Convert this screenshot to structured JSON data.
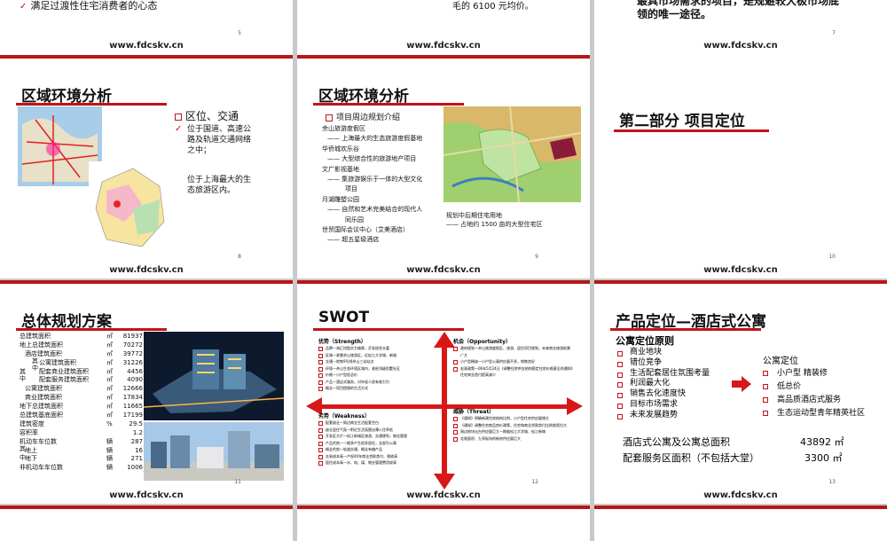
{
  "footer_url": "www.fdcskv.cn",
  "colors": {
    "accent": "#c0141b",
    "background": "#c9c9c9"
  },
  "slide5": {
    "bullet": "满足过渡性住宅消费者的心态",
    "num": "5"
  },
  "slide6": {
    "text": "毛的 6100 元均价。",
    "num": ""
  },
  "slide7": {
    "line1": "最具市场需求的项目，是规避较大极市场底",
    "line2": "领的唯一途径。",
    "num": "7"
  },
  "slide8": {
    "title": "区域环境分析",
    "heading": "区位、交通",
    "item1": [
      "位于国道、高速公",
      "路及轨道交通网络",
      "之中；"
    ],
    "item2": [
      "位于上海最大的生",
      "态旅游区内。"
    ],
    "num": "8"
  },
  "slide9": {
    "title": "区域环境分析",
    "heading": "项目周边规划介绍",
    "lines": [
      "佘山旅游度假区",
      "—— 上海最大的生态旅游度假基地",
      "华侨城欢乐谷",
      "—— 大型综合性的旅游地产项目",
      "文广影视基地",
      "—— 集旅游娱乐于一体的大型文化",
      "项目",
      "月湖雕塑公园",
      "—— 自然和艺术完美结合的现代人",
      "同乐园",
      "世贸国际会议中心（艾美酒店）",
      "—— 超五星级酒店"
    ],
    "note1": "规划中后期住宅用地",
    "note2": "—— 占地约 1500 亩的大型住宅区",
    "num": "9"
  },
  "slide10": {
    "title": "第二部分  项目定位",
    "num": "10"
  },
  "slide11": {
    "title": "总体规划方案",
    "rows": [
      {
        "label": "总建筑面积",
        "unit": "㎡",
        "value": "81937"
      },
      {
        "label": "地上总建筑面积",
        "unit": "㎡",
        "value": "70272"
      },
      {
        "label": "酒店建筑面积",
        "unit": "㎡",
        "value": "39772"
      },
      {
        "label": "公寓建筑面积",
        "unit": "㎡",
        "value": "31226"
      },
      {
        "label": "配套商业建筑面积",
        "unit": "㎡",
        "value": "4456"
      },
      {
        "label": "配套服务建筑面积",
        "unit": "㎡",
        "value": "4090"
      },
      {
        "label": "公寓建筑面积",
        "unit": "㎡",
        "value": "12666"
      },
      {
        "label": "商业建筑面积",
        "unit": "㎡",
        "value": "17834"
      },
      {
        "label": "地下总建筑面积",
        "unit": "㎡",
        "value": "11665"
      },
      {
        "label": "总建筑基底面积",
        "unit": "㎡",
        "value": "17199"
      },
      {
        "label": "建筑密度",
        "unit": "%",
        "value": "29.5"
      },
      {
        "label": "容积率",
        "unit": "",
        "value": "1.2"
      },
      {
        "label": "机动车车位数",
        "unit": "辆",
        "value": "287"
      },
      {
        "label": "地上",
        "unit": "辆",
        "value": "16"
      },
      {
        "label": "地下",
        "unit": "辆",
        "value": "271"
      },
      {
        "label": "非机动车车位数",
        "unit": "辆",
        "value": "1006"
      }
    ],
    "group1": [
      "其",
      "中"
    ],
    "group2": [
      "其",
      "中"
    ],
    "group3": [
      "其",
      "中"
    ],
    "num": "11"
  },
  "slide12": {
    "title": "SWOT",
    "s_title": "优势（Strength）",
    "s_items": [
      "品牌—海汇控股实力雄厚，开发经验丰富",
      "区域—紧靠佘山旅游区，近松江大学城、新城",
      "交通—地铁9号线佘山三站站点",
      "环境—佘山生态环境区域内，紧依顶级别墅社区",
      "价格—小户型低总价",
      "产品—酒店式服务，对年轻人很有吸引力",
      "概念—项目提倡的生活方式"
    ],
    "o_title": "机会（Opportunity）",
    "o_items": [
      "政府规划—佘山旅游度假区、旅游、居住项目规划，未来商业旅游前景广大",
      "小户型稀缺—小户型公寓供应量不多，销售良好",
      "宏观政策—06年5月24日《调整住房供应结构稳定住房价格意见的通知》住宅商业首付提高减少"
    ],
    "w_title": "劣势（Weakness）",
    "w_items": [
      "配套缺乏—周边商业生活配套空白",
      "缺乏居住气氛—附近生活氛围淡薄入住率低",
      "开发区大片—松江新城区旅游、交通便利，物业管理",
      "产品劣势—一楼多产生很多居住，全部为公寓",
      "概念劣势—轨道交通、概念有偏产品",
      "交易成本高—产权40年商业贷款首付、税收高",
      "居住成本高—水、电、煤、物业管理费用较高"
    ],
    "t_title": "威胁（Threat）",
    "t_items": [
      "《通知》明确新建住房结构比例，小户型住宅供应量增大",
      "《通知》调整住宅商品房价政策，住宅和商业贷款首付比例差距拉大",
      "周边地块出台供应量巨大一期临松江大学城、松江新城",
      "北侧面积、九亭板块的新房供应量巨大"
    ],
    "num": "12"
  },
  "slide13": {
    "title": "产品定位—酒店式公寓",
    "principle_title": "公寓定位原则",
    "principles": [
      "商业地块",
      "错位竞争",
      "生活配套居住氛围考量",
      "利润最大化",
      "销售去化速度快",
      "目标市场需求",
      "未来发展趋势"
    ],
    "position_title": "公寓定位",
    "positions": [
      "小户型 精装修",
      "低总价",
      "高品质酒店式服务",
      "生态运动型青年精英社区"
    ],
    "area1_label": "酒店式公寓及公寓总面积",
    "area1_value": "43892 ㎡",
    "area2_label": "配套服务区面积（不包括大堂）",
    "area2_value": "3300 ㎡",
    "num": "13"
  }
}
